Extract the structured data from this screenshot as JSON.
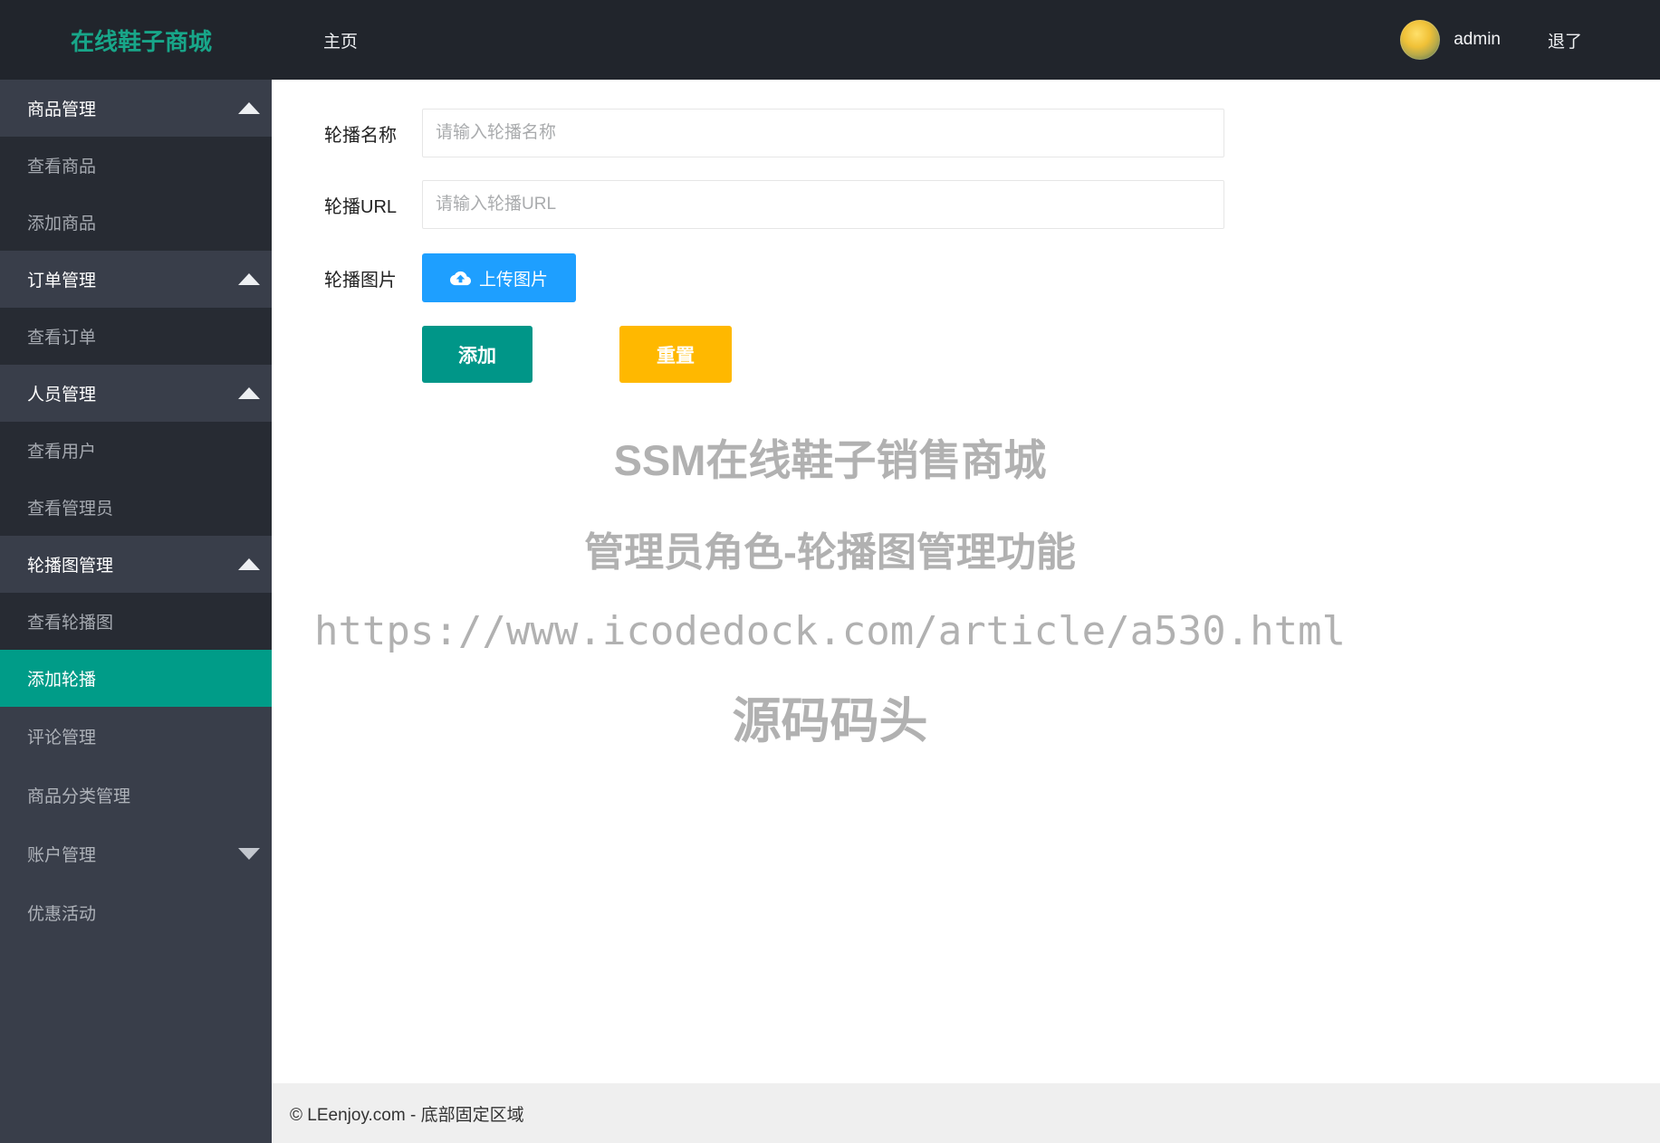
{
  "navbar": {
    "brand": "在线鞋子商城",
    "home": "主页",
    "username": "admin",
    "logout": "退了"
  },
  "sidebar": {
    "items": [
      {
        "name": "goods-management",
        "label": "商品管理",
        "type": "header",
        "caret": "up",
        "active": false
      },
      {
        "name": "view-goods",
        "label": "查看商品",
        "type": "sub",
        "caret": null,
        "active": false
      },
      {
        "name": "add-goods",
        "label": "添加商品",
        "type": "sub",
        "caret": null,
        "active": false
      },
      {
        "name": "order-management",
        "label": "订单管理",
        "type": "header",
        "caret": "up",
        "active": false
      },
      {
        "name": "view-orders",
        "label": "查看订单",
        "type": "sub",
        "caret": null,
        "active": false
      },
      {
        "name": "staff-management",
        "label": "人员管理",
        "type": "header",
        "caret": "up",
        "active": false
      },
      {
        "name": "view-users",
        "label": "查看用户",
        "type": "sub",
        "caret": null,
        "active": false
      },
      {
        "name": "view-admins",
        "label": "查看管理员",
        "type": "sub",
        "caret": null,
        "active": false
      },
      {
        "name": "carousel-management",
        "label": "轮播图管理",
        "type": "header",
        "caret": "up",
        "active": false
      },
      {
        "name": "view-carousel",
        "label": "查看轮播图",
        "type": "sub",
        "caret": null,
        "active": false
      },
      {
        "name": "add-carousel",
        "label": "添加轮播",
        "type": "sub",
        "caret": null,
        "active": true
      },
      {
        "name": "comment-management",
        "label": "评论管理",
        "type": "item",
        "caret": null,
        "active": false
      },
      {
        "name": "category-management",
        "label": "商品分类管理",
        "type": "item",
        "caret": null,
        "active": false
      },
      {
        "name": "account-management",
        "label": "账户管理",
        "type": "item",
        "caret": "down",
        "active": false
      },
      {
        "name": "promotions",
        "label": "优惠活动",
        "type": "item",
        "caret": null,
        "active": false
      }
    ]
  },
  "form": {
    "name_label": "轮播名称",
    "name_placeholder": "请输入轮播名称",
    "name_value": "",
    "url_label": "轮播URL",
    "url_placeholder": "请输入轮播URL",
    "url_value": "",
    "image_label": "轮播图片",
    "upload_button": "上传图片",
    "upload_icon": "cloud-upload-icon",
    "add_button": "添加",
    "reset_button": "重置"
  },
  "watermark": {
    "line1": "SSM在线鞋子销售商城",
    "line2": "管理员角色-轮播图管理功能",
    "line3": "https://www.icodedock.com/article/a530.html",
    "line4": "源码码头"
  },
  "footer": {
    "text": "© LEenjoy.com - 底部固定区域"
  },
  "colors": {
    "navbar_bg": "#21252c",
    "sidebar_bg": "#393e4a",
    "sidebar_sub_bg": "#272b33",
    "brand_teal": "#18a689",
    "active_teal": "#009c88",
    "button_blue": "#1e9fff",
    "button_green": "#009688",
    "button_yellow": "#ffb800",
    "watermark_gray": "#b1b1b1",
    "footer_bg": "#efefef"
  }
}
